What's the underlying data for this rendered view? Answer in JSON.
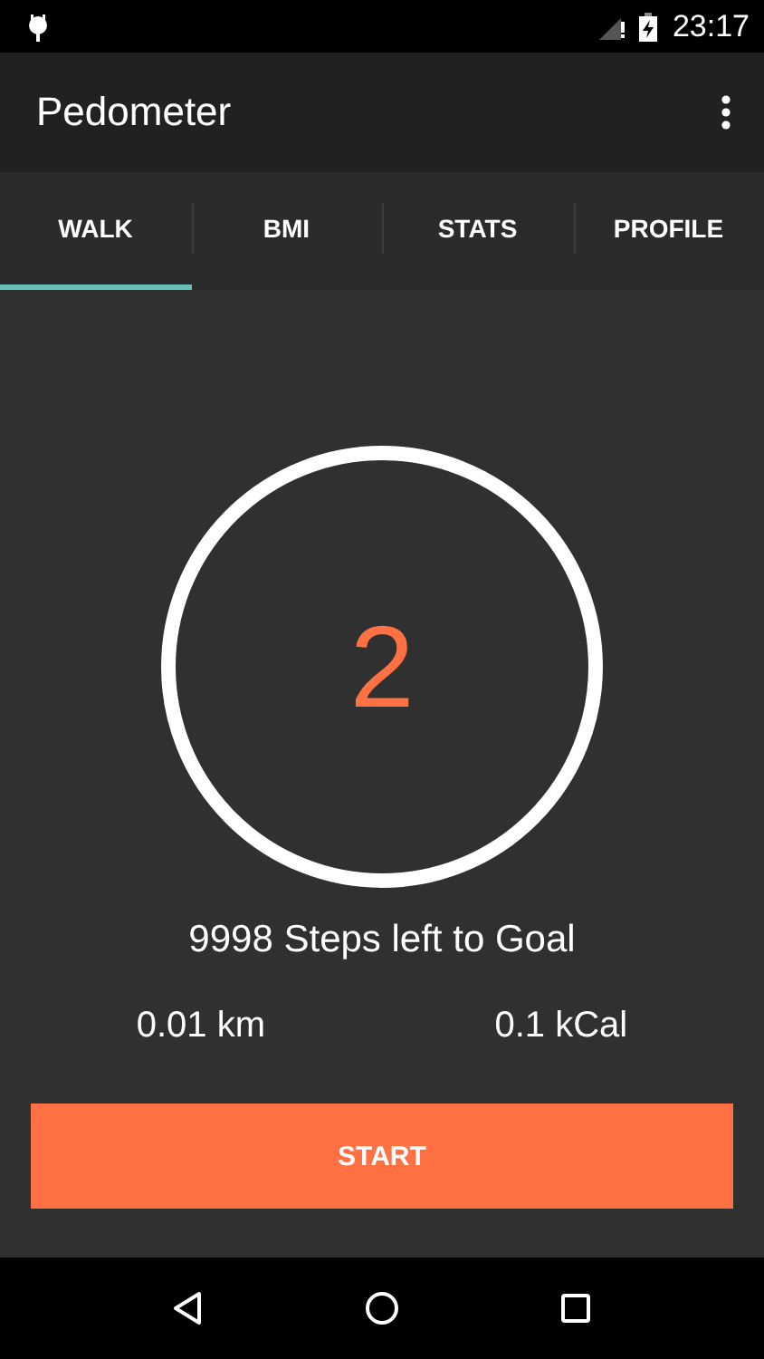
{
  "status_bar": {
    "time": "23:17"
  },
  "app_bar": {
    "title": "Pedometer"
  },
  "tabs": [
    {
      "label": "WALK",
      "selected": true
    },
    {
      "label": "BMI",
      "selected": false
    },
    {
      "label": "STATS",
      "selected": false
    },
    {
      "label": "PROFILE",
      "selected": false
    }
  ],
  "step_count": "2",
  "steps_left": "9998 Steps left to Goal",
  "distance": "0.01 km",
  "calories": "0.1 kCal",
  "start_button": "START"
}
